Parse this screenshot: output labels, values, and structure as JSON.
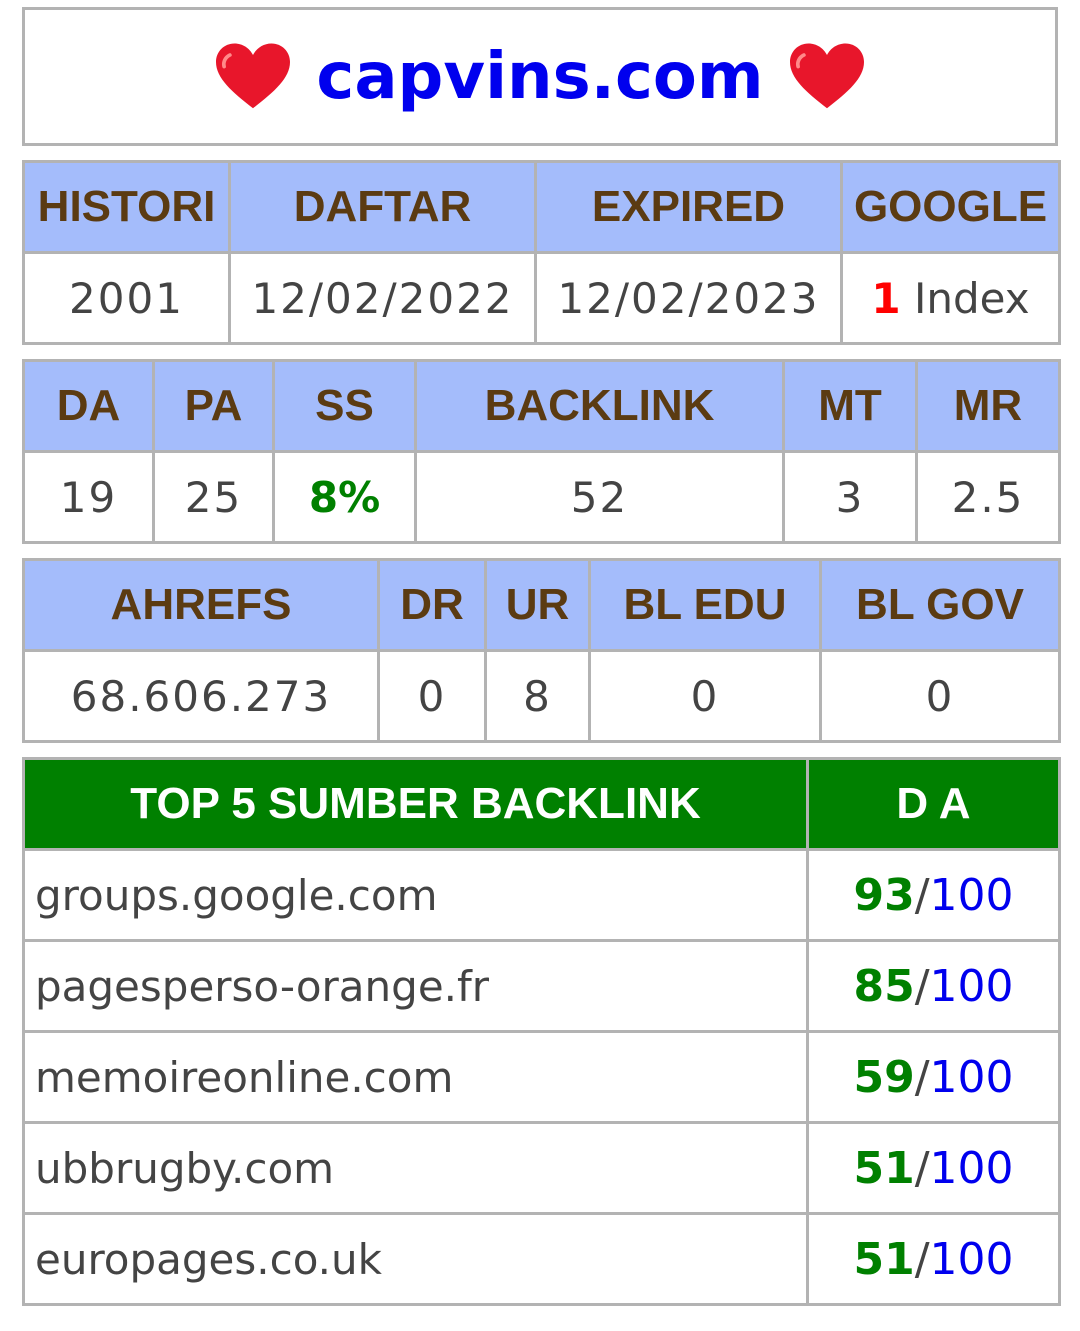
{
  "header": {
    "domain": "capvins.com",
    "left_icon": "heart-icon",
    "right_icon": "heart-icon",
    "heart_color": "#e8162b"
  },
  "info": {
    "headers": [
      "HISTORI",
      "DAFTAR",
      "EXPIRED",
      "GOOGLE"
    ],
    "values": {
      "histori": "2001",
      "daftar": "12/02/2022",
      "expired": "12/02/2023",
      "google_count": "1",
      "google_label": "Index"
    }
  },
  "moz": {
    "headers": [
      "DA",
      "PA",
      "SS",
      "BACKLINK",
      "MT",
      "MR"
    ],
    "values": [
      "19",
      "25",
      "8%",
      "52",
      "3",
      "2.5"
    ]
  },
  "ahrefs": {
    "headers": [
      "AHREFS",
      "DR",
      "UR",
      "BL EDU",
      "BL GOV"
    ],
    "values": [
      "68.606.273",
      "0",
      "8",
      "0",
      "0"
    ]
  },
  "top_backlinks": {
    "title": "TOP 5 SUMBER BACKLINK",
    "da_header": "D A",
    "separator": "/",
    "max": "100",
    "rows": [
      {
        "site": "groups.google.com",
        "da": "93"
      },
      {
        "site": "pagesperso-orange.fr",
        "da": "85"
      },
      {
        "site": "memoireonline.com",
        "da": "59"
      },
      {
        "site": "ubbrugby.com",
        "da": "51"
      },
      {
        "site": "europages.co.uk",
        "da": "51"
      }
    ]
  },
  "colors": {
    "header_bg": "#a4bcfb",
    "header_text": "#5b3b12",
    "top_header_bg": "#008000",
    "link_blue": "#0000ee",
    "accent_green": "#008000",
    "accent_red": "#ff0000"
  }
}
